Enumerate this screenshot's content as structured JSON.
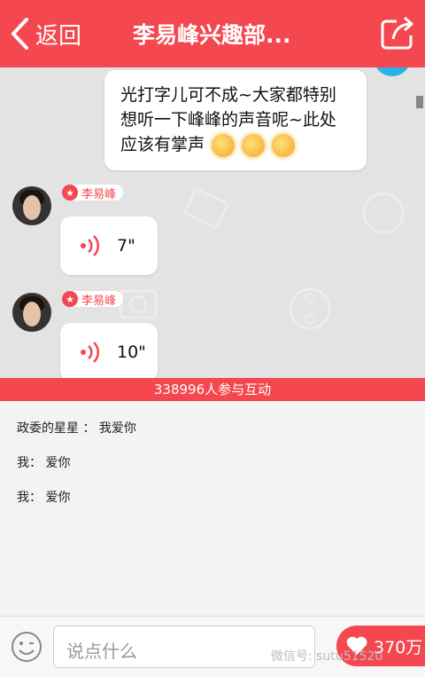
{
  "header": {
    "back_label": "返回",
    "title": "李易峰兴趣部...",
    "back_icon": "chevron-left-icon",
    "share_icon": "share-icon"
  },
  "chat": {
    "self_message": {
      "text": "光打字儿可不成~大家都特别想听一下峰峰的声音呢~此处应该有掌声",
      "emoji_icon": "blush-emoji-icon"
    },
    "voice_messages": [
      {
        "sender": "李易峰",
        "duration": "7\""
      },
      {
        "sender": "李易峰",
        "duration": "10\""
      }
    ]
  },
  "banner": {
    "text": "338996人参与互动"
  },
  "comments": [
    {
      "text": "政委的星星 ： 我爱你"
    },
    {
      "text": "我： 爱你"
    },
    {
      "text": "我： 爱你"
    }
  ],
  "bottom_bar": {
    "input_placeholder": "说点什么",
    "like_count": "370万",
    "watermark": "微信号: sutu51520"
  },
  "colors": {
    "accent": "#f5474f",
    "chat_bg": "#e3e3e3",
    "self_avatar": "#2ab1e6"
  }
}
